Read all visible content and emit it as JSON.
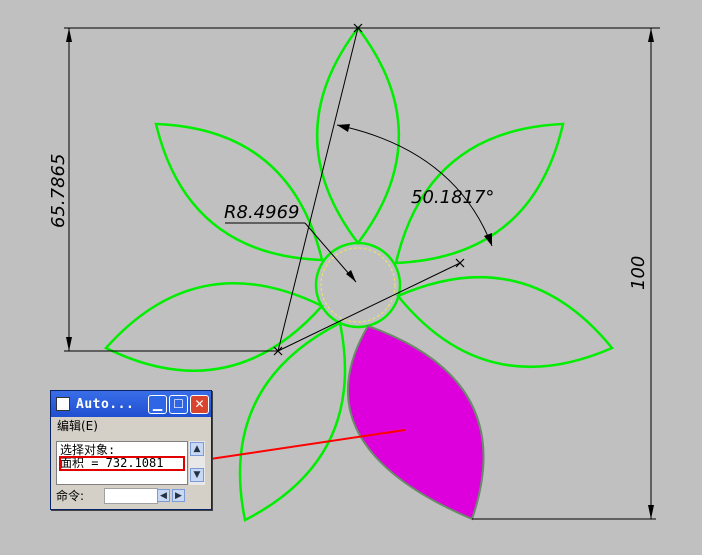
{
  "drawing": {
    "dimensions": {
      "left_height": "65.7865",
      "radius": "R8.4969",
      "angle": "50.1817°",
      "right_height": "100"
    },
    "colors": {
      "petal_outline": "#00ee00",
      "highlight_fill": "#dd00dd",
      "callout_arrow": "#ff0000",
      "dimension_line": "#000000",
      "hidden_circle": "#e8e860"
    }
  },
  "command_window": {
    "title": "Auto...",
    "menu": "编辑(E)",
    "lines": [
      "选择对象:",
      "面积 = 732.1081"
    ],
    "prompt": "命令:",
    "icons": [
      "app-icon",
      "minimize-icon",
      "maximize-icon",
      "close-icon",
      "scroll-up-icon",
      "scroll-down-icon",
      "scroll-left-icon",
      "scroll-right-icon"
    ]
  }
}
